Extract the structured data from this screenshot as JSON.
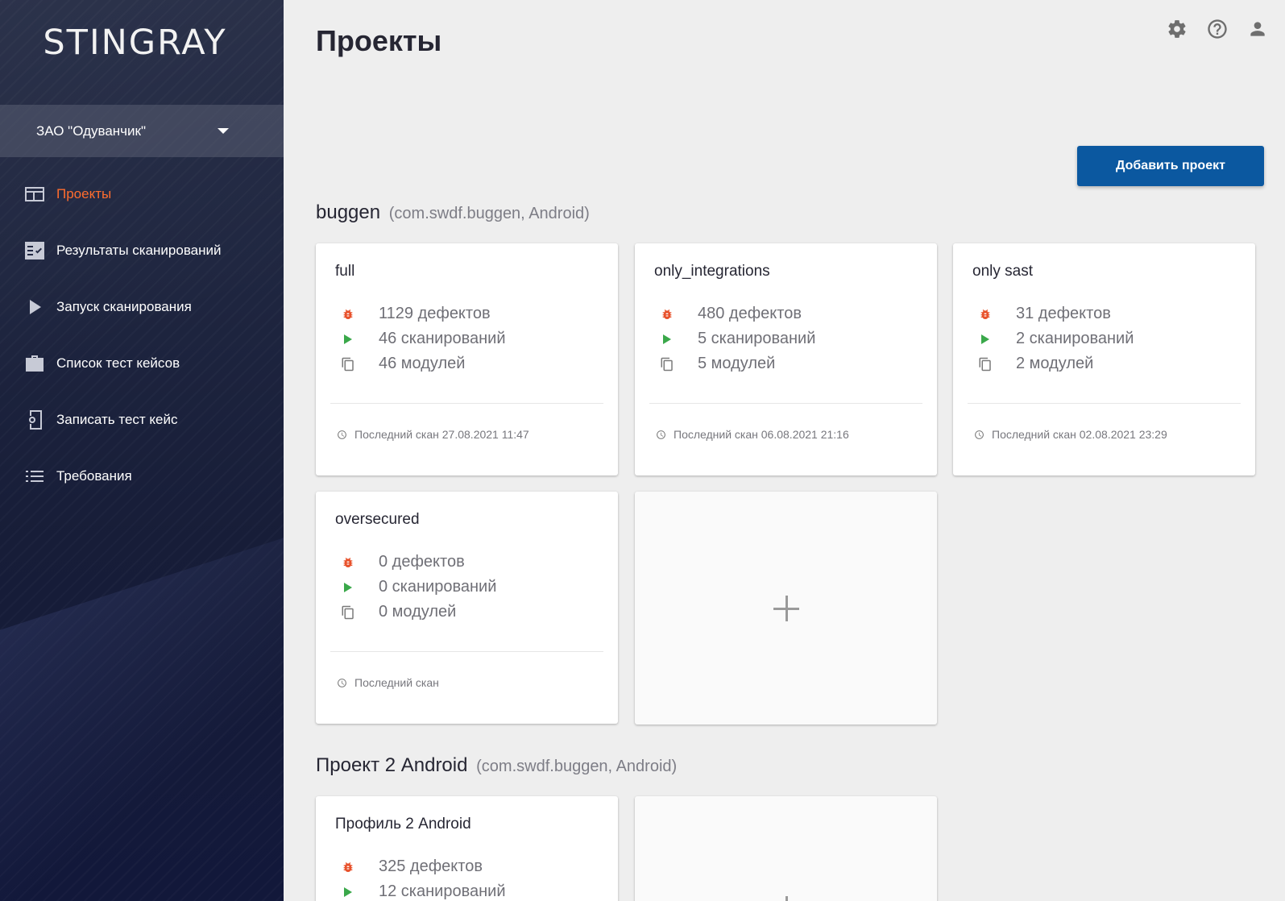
{
  "app": {
    "logo": "STINGRAY"
  },
  "org": {
    "name": "ЗАО \"Одуванчик\""
  },
  "sidebar": {
    "items": [
      {
        "label": "Проекты",
        "icon": "projects-icon",
        "active": true
      },
      {
        "label": "Результаты сканирований",
        "icon": "scan-results-icon"
      },
      {
        "label": "Запуск сканирования",
        "icon": "play-icon"
      },
      {
        "label": "Список тест кейсов",
        "icon": "briefcase-icon"
      },
      {
        "label": "Записать тест кейс",
        "icon": "record-device-icon"
      },
      {
        "label": "Требования",
        "icon": "list-icon"
      }
    ]
  },
  "header": {
    "title": "Проекты",
    "icons": [
      "settings-gear-icon",
      "help-icon",
      "account-icon"
    ]
  },
  "actions": {
    "add_project": "Добавить проект"
  },
  "colors": {
    "accent": "#ff6d2e",
    "primary_button": "#0b58a0",
    "bug": "#e8522c",
    "play": "#3aa84a"
  },
  "groups": [
    {
      "name": "buggen",
      "meta": "(com.swdf.buggen, Android)",
      "profiles": [
        {
          "title": "full",
          "defects": "1129 дефектов",
          "scans": "46 сканирований",
          "modules": "46 модулей",
          "last_scan": "Последний скан 27.08.2021 11:47"
        },
        {
          "title": "only_integrations",
          "defects": "480 дефектов",
          "scans": "5 сканирований",
          "modules": "5 модулей",
          "last_scan": "Последний скан 06.08.2021 21:16"
        },
        {
          "title": "only sast",
          "defects": "31 дефектов",
          "scans": "2 сканирований",
          "modules": "2 модулей",
          "last_scan": "Последний скан 02.08.2021 23:29"
        },
        {
          "title": "oversecured",
          "defects": "0 дефектов",
          "scans": "0 сканирований",
          "modules": "0 модулей",
          "last_scan": "Последний скан"
        }
      ]
    },
    {
      "name": "Проект 2 Android",
      "meta": "(com.swdf.buggen, Android)",
      "profiles": [
        {
          "title": "Профиль 2 Android",
          "defects": "325 дефектов",
          "scans": "12 сканирований"
        }
      ]
    }
  ]
}
